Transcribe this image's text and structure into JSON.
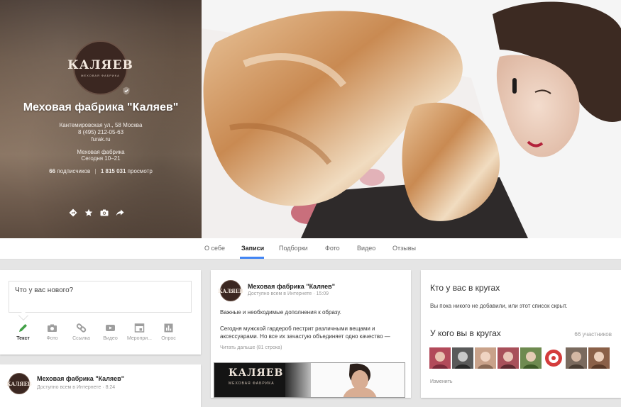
{
  "profile": {
    "logo_text": "КАЛЯЕВ",
    "logo_subtitle": "МЕХОВАЯ ФАБРИКА",
    "name": "Меховая фабрика \"Каляев\"",
    "address": "Кантемировская ул., 58 Москва",
    "phone": "8 (495) 212-05-63",
    "website": "furak.ru",
    "category": "Меховая фабрика",
    "hours": "Сегодня 10–21",
    "followers_count": "66",
    "followers_label": "подписчиков",
    "separator": "|",
    "views_count": "1 815 031",
    "views_label": "просмотр",
    "actions": [
      "directions-icon",
      "star-icon",
      "camera-icon",
      "share-icon"
    ]
  },
  "tabs": [
    {
      "label": "О себе"
    },
    {
      "label": "Записи"
    },
    {
      "label": "Подборки"
    },
    {
      "label": "Фото"
    },
    {
      "label": "Видео"
    },
    {
      "label": "Отзывы"
    }
  ],
  "active_tab": "Записи",
  "composer": {
    "placeholder": "Что у вас нового?",
    "tools": [
      {
        "label": "Текст",
        "icon": "pencil-icon",
        "color": "#43a047"
      },
      {
        "label": "Фото",
        "icon": "camera-icon",
        "color": "#9e9e9e"
      },
      {
        "label": "Ссылка",
        "icon": "link-icon",
        "color": "#9e9e9e"
      },
      {
        "label": "Видео",
        "icon": "video-icon",
        "color": "#9e9e9e"
      },
      {
        "label": "Меропри...",
        "icon": "event-icon",
        "color": "#9e9e9e"
      },
      {
        "label": "Опрос",
        "icon": "poll-icon",
        "color": "#9e9e9e"
      }
    ]
  },
  "post": {
    "avatar_text": "КАЛЯЕВ",
    "author": "Меховая фабрика \"Каляев\"",
    "visibility": "Доступно всем в Интернете",
    "dot": "·",
    "time": "15:09",
    "paragraph1": "Важные и необходимые дополнения к образу.",
    "paragraph2": "Сегодня мужской гардероб пестрит различными вещами и аксессуарами. Но все их зачастую объединяет одно качество —",
    "read_more": "Читать дальше (81 строка)",
    "image_logo": "КАЛЯЕВ",
    "image_logo_sub": "МЕХОВАЯ ФАБРИКА"
  },
  "post2": {
    "avatar_text": "КАЛЯЕВ",
    "author": "Меховая фабрика \"Каляев\"",
    "visibility": "Доступно всем в Интернете",
    "dot": "·",
    "time": "8:24"
  },
  "circles": {
    "in_their_title": "Кто у вас в кругах",
    "in_their_text": "Вы пока никого не добавили, или этот список скрыт.",
    "have_you_title": "У кого вы в кругах",
    "have_you_count": "66 участников",
    "edit_label": "Изменить",
    "faces": [
      "#b24a5a",
      "#5a5a5a",
      "#c9a28a",
      "#a8505a",
      "#6e8a50",
      "#d43c3c",
      "#7a6a5e",
      "#8a6048"
    ]
  }
}
